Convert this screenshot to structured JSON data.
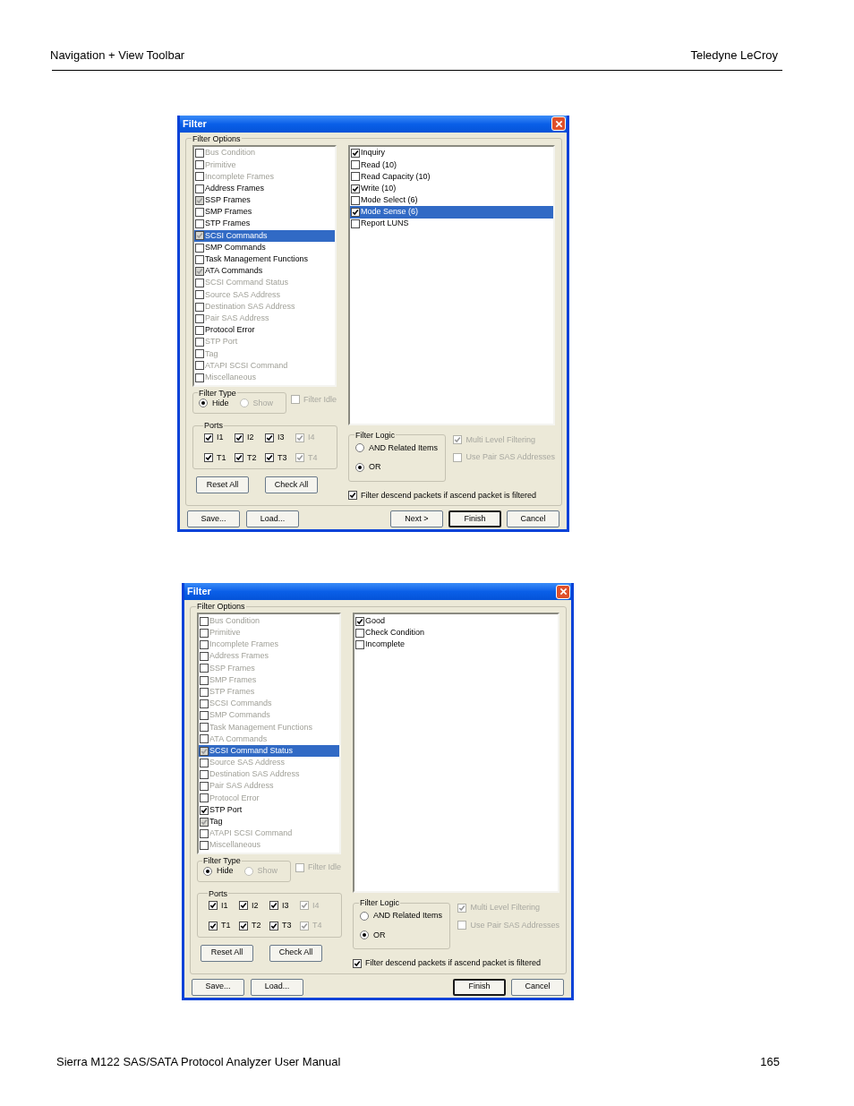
{
  "header": {
    "section": "Navigation + View Toolbar",
    "company": "Teledyne LeCroy"
  },
  "dialogs": [
    {
      "title": "Filter",
      "group_label": "Filter Options",
      "categories": [
        {
          "label": "Bus Condition",
          "checked": false,
          "partial": false,
          "disabled": true,
          "selected": false
        },
        {
          "label": "Primitive",
          "checked": false,
          "partial": false,
          "disabled": true,
          "selected": false
        },
        {
          "label": "Incomplete Frames",
          "checked": false,
          "partial": false,
          "disabled": true,
          "selected": false
        },
        {
          "label": "Address Frames",
          "checked": false,
          "partial": false,
          "disabled": false,
          "selected": false
        },
        {
          "label": "SSP Frames",
          "checked": true,
          "partial": true,
          "disabled": false,
          "selected": false
        },
        {
          "label": "SMP Frames",
          "checked": false,
          "partial": false,
          "disabled": false,
          "selected": false
        },
        {
          "label": "STP Frames",
          "checked": false,
          "partial": false,
          "disabled": false,
          "selected": false
        },
        {
          "label": "SCSI Commands",
          "checked": true,
          "partial": true,
          "disabled": false,
          "selected": true
        },
        {
          "label": "SMP Commands",
          "checked": false,
          "partial": false,
          "disabled": false,
          "selected": false
        },
        {
          "label": "Task Management Functions",
          "checked": false,
          "partial": false,
          "disabled": false,
          "selected": false
        },
        {
          "label": "ATA Commands",
          "checked": true,
          "partial": true,
          "disabled": false,
          "selected": false
        },
        {
          "label": "SCSI Command Status",
          "checked": false,
          "partial": false,
          "disabled": true,
          "selected": false
        },
        {
          "label": "Source SAS Address",
          "checked": false,
          "partial": false,
          "disabled": true,
          "selected": false
        },
        {
          "label": "Destination SAS Address",
          "checked": false,
          "partial": false,
          "disabled": true,
          "selected": false
        },
        {
          "label": "Pair SAS Address",
          "checked": false,
          "partial": false,
          "disabled": true,
          "selected": false
        },
        {
          "label": "Protocol Error",
          "checked": false,
          "partial": false,
          "disabled": false,
          "selected": false
        },
        {
          "label": "STP Port",
          "checked": false,
          "partial": false,
          "disabled": true,
          "selected": false
        },
        {
          "label": "Tag",
          "checked": false,
          "partial": false,
          "disabled": true,
          "selected": false
        },
        {
          "label": "ATAPI SCSI Command",
          "checked": false,
          "partial": false,
          "disabled": true,
          "selected": false
        },
        {
          "label": "Miscellaneous",
          "checked": false,
          "partial": false,
          "disabled": true,
          "selected": false
        }
      ],
      "subitems": [
        {
          "label": "Inquiry",
          "checked": true,
          "selected": false
        },
        {
          "label": "Read (10)",
          "checked": false,
          "selected": false
        },
        {
          "label": "Read Capacity (10)",
          "checked": false,
          "selected": false
        },
        {
          "label": "Write (10)",
          "checked": true,
          "selected": false
        },
        {
          "label": "Mode Select (6)",
          "checked": false,
          "selected": false
        },
        {
          "label": "Mode Sense (6)",
          "checked": true,
          "selected": true
        },
        {
          "label": "Report LUNS",
          "checked": false,
          "selected": false
        }
      ],
      "filter_type": {
        "label": "Filter Type",
        "options": [
          {
            "label": "Hide",
            "selected": true,
            "disabled": false
          },
          {
            "label": "Show",
            "selected": false,
            "disabled": true
          }
        ]
      },
      "filter_idle": {
        "label": "Filter Idle",
        "checked": false,
        "disabled": true
      },
      "ports": {
        "label": "Ports",
        "items": [
          {
            "label": "I1",
            "checked": true,
            "disabled": false
          },
          {
            "label": "I2",
            "checked": true,
            "disabled": false
          },
          {
            "label": "I3",
            "checked": true,
            "disabled": false
          },
          {
            "label": "I4",
            "checked": true,
            "disabled": true
          },
          {
            "label": "T1",
            "checked": true,
            "disabled": false
          },
          {
            "label": "T2",
            "checked": true,
            "disabled": false
          },
          {
            "label": "T3",
            "checked": true,
            "disabled": false
          },
          {
            "label": "T4",
            "checked": true,
            "disabled": true
          }
        ]
      },
      "port_buttons": [
        "Reset All",
        "Check All"
      ],
      "filter_logic": {
        "label": "Filter Logic",
        "options": [
          {
            "label": "AND Related Items",
            "selected": false
          },
          {
            "label": "OR",
            "selected": true
          }
        ]
      },
      "options": [
        {
          "label": "Multi Level Filtering",
          "checked": true,
          "disabled": true
        },
        {
          "label": "Use Pair SAS Addresses",
          "checked": false,
          "disabled": true
        }
      ],
      "descend": {
        "label": "Filter descend packets if ascend packet is filtered",
        "checked": true,
        "disabled": false
      },
      "buttons_left": [
        {
          "label": "Save...",
          "default": false
        },
        {
          "label": "Load...",
          "default": false
        }
      ],
      "buttons_right": [
        {
          "label": "Next >",
          "default": false
        },
        {
          "label": "Finish",
          "default": true
        },
        {
          "label": "Cancel",
          "default": false
        }
      ]
    },
    {
      "title": "Filter",
      "group_label": "Filter Options",
      "categories": [
        {
          "label": "Bus Condition",
          "checked": false,
          "partial": false,
          "disabled": true,
          "selected": false
        },
        {
          "label": "Primitive",
          "checked": false,
          "partial": false,
          "disabled": true,
          "selected": false
        },
        {
          "label": "Incomplete Frames",
          "checked": false,
          "partial": false,
          "disabled": true,
          "selected": false
        },
        {
          "label": "Address Frames",
          "checked": false,
          "partial": false,
          "disabled": true,
          "selected": false
        },
        {
          "label": "SSP Frames",
          "checked": false,
          "partial": false,
          "disabled": true,
          "selected": false
        },
        {
          "label": "SMP Frames",
          "checked": false,
          "partial": false,
          "disabled": true,
          "selected": false
        },
        {
          "label": "STP Frames",
          "checked": false,
          "partial": false,
          "disabled": true,
          "selected": false
        },
        {
          "label": "SCSI Commands",
          "checked": false,
          "partial": false,
          "disabled": true,
          "selected": false
        },
        {
          "label": "SMP Commands",
          "checked": false,
          "partial": false,
          "disabled": true,
          "selected": false
        },
        {
          "label": "Task Management Functions",
          "checked": false,
          "partial": false,
          "disabled": true,
          "selected": false
        },
        {
          "label": "ATA Commands",
          "checked": false,
          "partial": false,
          "disabled": true,
          "selected": false
        },
        {
          "label": "SCSI Command Status",
          "checked": true,
          "partial": true,
          "disabled": false,
          "selected": true
        },
        {
          "label": "Source SAS Address",
          "checked": false,
          "partial": false,
          "disabled": true,
          "selected": false
        },
        {
          "label": "Destination SAS Address",
          "checked": false,
          "partial": false,
          "disabled": true,
          "selected": false
        },
        {
          "label": "Pair SAS Address",
          "checked": false,
          "partial": false,
          "disabled": true,
          "selected": false
        },
        {
          "label": "Protocol Error",
          "checked": false,
          "partial": false,
          "disabled": true,
          "selected": false
        },
        {
          "label": "STP Port",
          "checked": true,
          "partial": false,
          "disabled": false,
          "selected": false
        },
        {
          "label": "Tag",
          "checked": true,
          "partial": true,
          "disabled": false,
          "selected": false
        },
        {
          "label": "ATAPI SCSI Command",
          "checked": false,
          "partial": false,
          "disabled": true,
          "selected": false
        },
        {
          "label": "Miscellaneous",
          "checked": false,
          "partial": false,
          "disabled": true,
          "selected": false
        }
      ],
      "subitems": [
        {
          "label": "Good",
          "checked": true,
          "selected": false
        },
        {
          "label": "Check Condition",
          "checked": false,
          "selected": false
        },
        {
          "label": "Incomplete",
          "checked": false,
          "selected": false
        }
      ],
      "filter_type": {
        "label": "Filter Type",
        "options": [
          {
            "label": "Hide",
            "selected": true,
            "disabled": false
          },
          {
            "label": "Show",
            "selected": false,
            "disabled": true
          }
        ]
      },
      "filter_idle": {
        "label": "Filter Idle",
        "checked": false,
        "disabled": true
      },
      "ports": {
        "label": "Ports",
        "items": [
          {
            "label": "I1",
            "checked": true,
            "disabled": false
          },
          {
            "label": "I2",
            "checked": true,
            "disabled": false
          },
          {
            "label": "I3",
            "checked": true,
            "disabled": false
          },
          {
            "label": "I4",
            "checked": true,
            "disabled": true
          },
          {
            "label": "T1",
            "checked": true,
            "disabled": false
          },
          {
            "label": "T2",
            "checked": true,
            "disabled": false
          },
          {
            "label": "T3",
            "checked": true,
            "disabled": false
          },
          {
            "label": "T4",
            "checked": true,
            "disabled": true
          }
        ]
      },
      "port_buttons": [
        "Reset All",
        "Check All"
      ],
      "filter_logic": {
        "label": "Filter Logic",
        "options": [
          {
            "label": "AND Related Items",
            "selected": false
          },
          {
            "label": "OR",
            "selected": true
          }
        ]
      },
      "options": [
        {
          "label": "Multi Level Filtering",
          "checked": true,
          "disabled": true
        },
        {
          "label": "Use Pair SAS Addresses",
          "checked": false,
          "disabled": true
        }
      ],
      "descend": {
        "label": "Filter descend packets if ascend packet is filtered",
        "checked": true,
        "disabled": false
      },
      "buttons_left": [
        {
          "label": "Save...",
          "default": false
        },
        {
          "label": "Load...",
          "default": false
        }
      ],
      "buttons_right": [
        {
          "label": "Finish",
          "default": true
        },
        {
          "label": "Cancel",
          "default": false
        }
      ]
    }
  ],
  "footer": {
    "title": "Sierra M122 SAS/SATA Protocol Analyzer User Manual",
    "page": "165"
  }
}
